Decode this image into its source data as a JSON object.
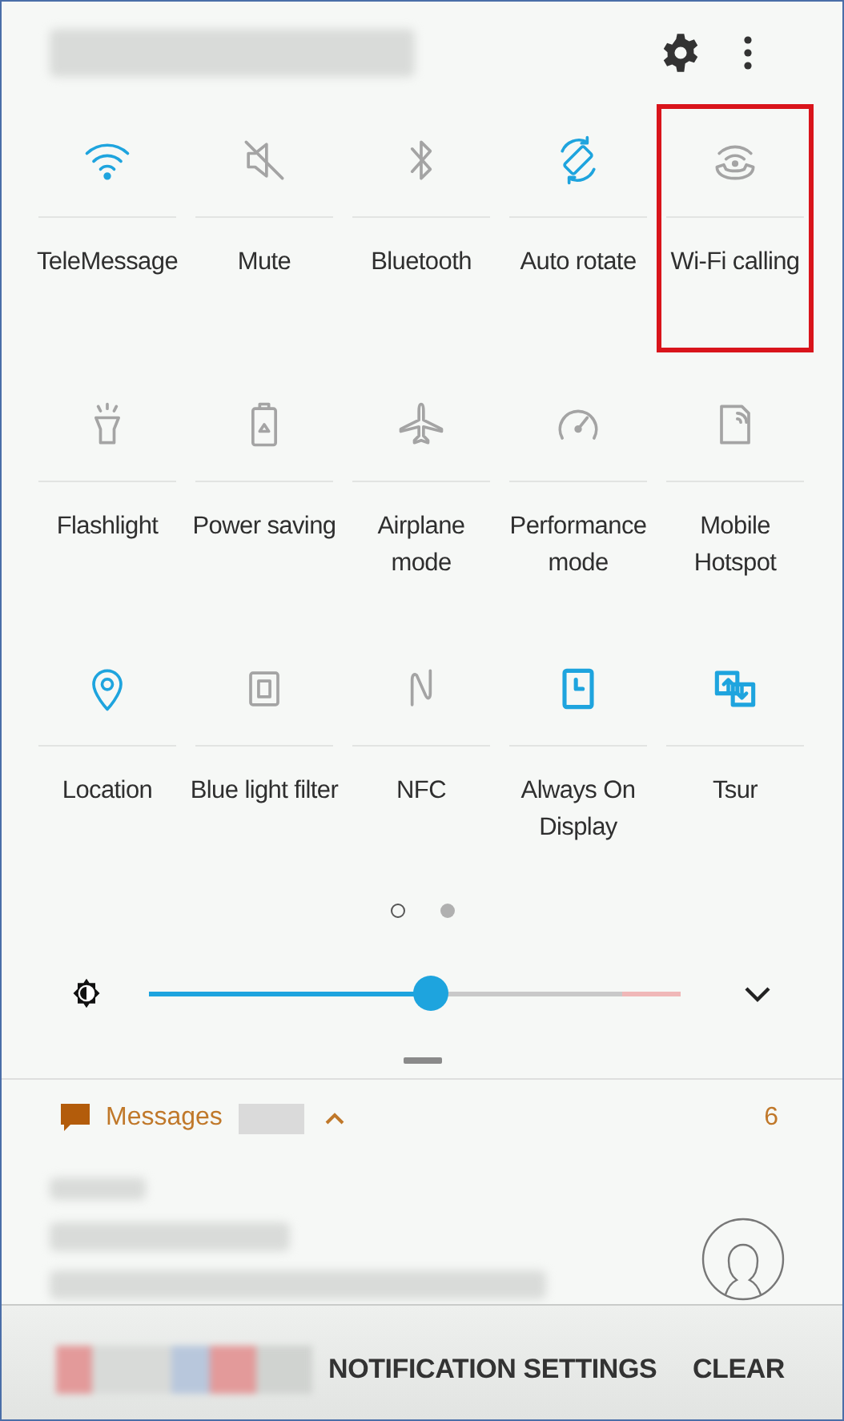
{
  "tiles": [
    {
      "label": "TeleMessage",
      "on": true,
      "highlighted": false
    },
    {
      "label": "Mute",
      "on": false,
      "highlighted": false
    },
    {
      "label": "Bluetooth",
      "on": false,
      "highlighted": false
    },
    {
      "label": "Auto rotate",
      "on": true,
      "highlighted": false
    },
    {
      "label": "Wi-Fi calling",
      "on": false,
      "highlighted": true
    },
    {
      "label": "Flashlight",
      "on": false,
      "highlighted": false
    },
    {
      "label": "Power saving",
      "on": false,
      "highlighted": false
    },
    {
      "label": "Airplane mode",
      "on": false,
      "highlighted": false
    },
    {
      "label": "Performance mode",
      "on": false,
      "highlighted": false
    },
    {
      "label": "Mobile Hotspot",
      "on": false,
      "highlighted": false
    },
    {
      "label": "Location",
      "on": true,
      "highlighted": false
    },
    {
      "label": "Blue light filter",
      "on": false,
      "highlighted": false
    },
    {
      "label": "NFC",
      "on": false,
      "highlighted": false
    },
    {
      "label": "Always On Display",
      "on": true,
      "highlighted": false
    },
    {
      "label": "Tsur",
      "on": true,
      "highlighted": false
    }
  ],
  "pages": [
    {
      "selected": true
    },
    {
      "selected": false
    }
  ],
  "brightness": {
    "level": 0.53
  },
  "notification": {
    "app": "Messages",
    "expanded": true,
    "count": "6"
  },
  "bottom_bar": {
    "buttons": [
      "NOTIFICATION SETTINGS",
      "CLEAR"
    ]
  }
}
